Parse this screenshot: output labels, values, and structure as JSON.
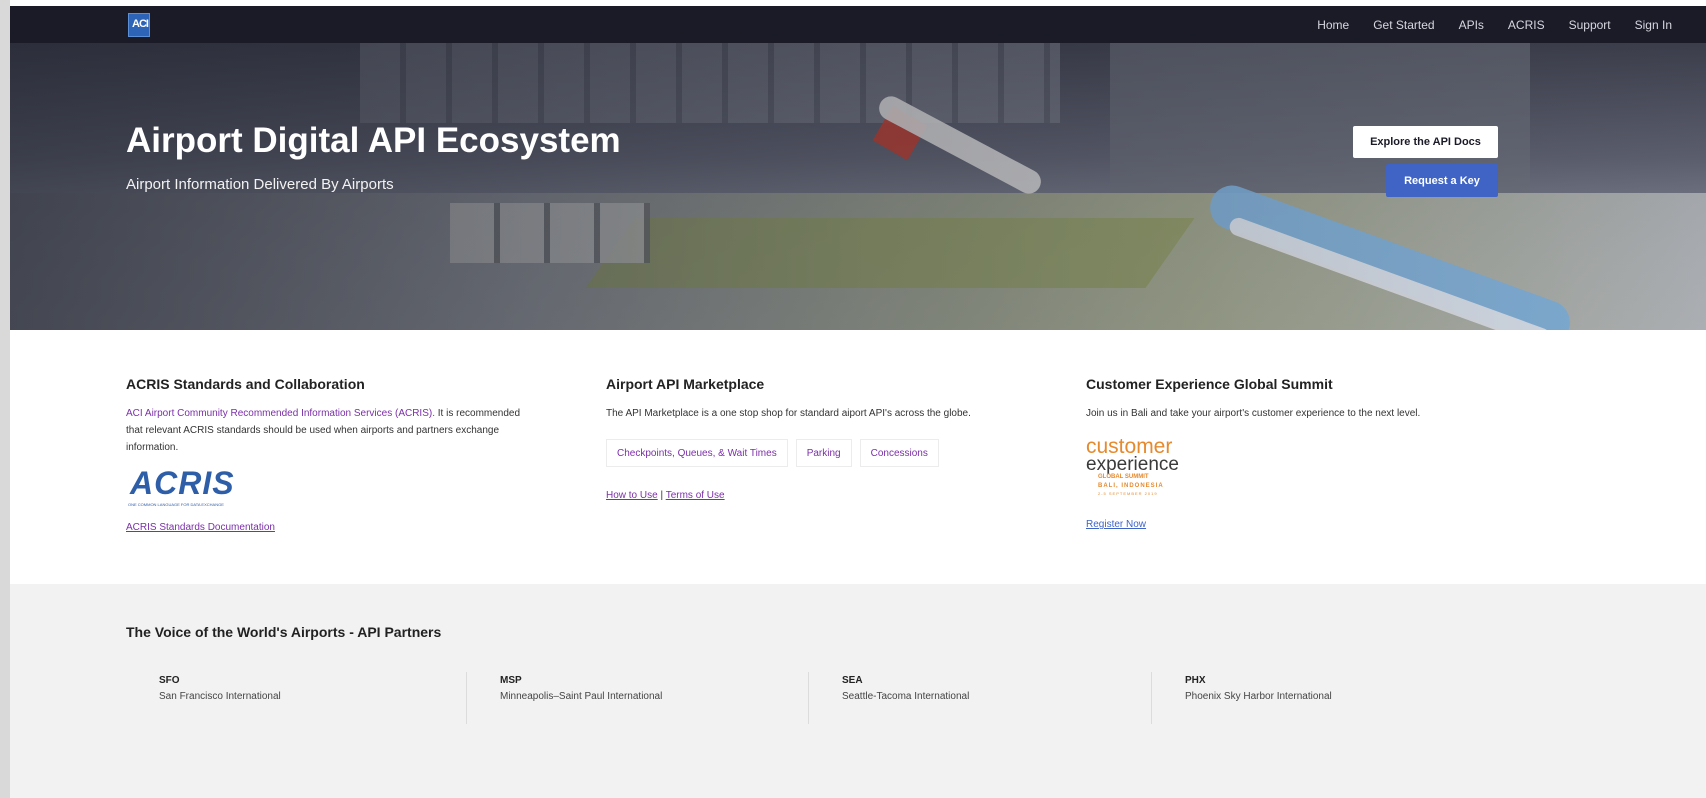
{
  "nav": {
    "logo_text": "ACI",
    "links": [
      "Home",
      "Get Started",
      "APIs",
      "ACRIS",
      "Support",
      "Sign In"
    ]
  },
  "hero": {
    "title": "Airport Digital API Ecosystem",
    "subtitle": "Airport Information Delivered By Airports",
    "docs_button": "Explore the API Docs",
    "key_button": "Request a Key"
  },
  "acris": {
    "heading": "ACRIS Standards and Collaboration",
    "link_text": "ACI Airport Community Recommended Information Services (ACRIS).",
    "body_text": " It is recommended that relevant ACRIS standards should be used when airports and partners exchange information.",
    "logo_text": "ACRIS",
    "logo_tagline": "ONE COMMON LANGUAGE FOR DATA EXCHANGE",
    "doc_link": "ACRIS Standards Documentation"
  },
  "marketplace": {
    "heading": "Airport API Marketplace",
    "body": "The API Marketplace is a one stop shop for standard aiport API's across the globe.",
    "pills": [
      "Checkpoints, Queues, & Wait Times",
      "Parking",
      "Concessions"
    ],
    "how_to_use": "How to Use",
    "separator": "|",
    "terms": "Terms of Use"
  },
  "summit": {
    "heading": "Customer Experience Global Summit",
    "body": "Join us in Bali and take your airport's customer experience to the next level.",
    "logo_line1": "customer",
    "logo_line2": "experience",
    "logo_line3": "GLOBAL SUMMIT",
    "logo_line4": "BALI, INDONESIA",
    "logo_line5": "2-5 SEPTEMBER 2019",
    "register": "Register Now"
  },
  "partners": {
    "heading": "The Voice of the World's Airports - API Partners",
    "items": [
      {
        "code": "SFO",
        "name": "San Francisco International"
      },
      {
        "code": "MSP",
        "name": "Minneapolis–Saint Paul International"
      },
      {
        "code": "SEA",
        "name": "Seattle-Tacoma International"
      },
      {
        "code": "PHX",
        "name": "Phoenix Sky Harbor International"
      }
    ]
  },
  "colors": {
    "nav_bg": "#1b1b28",
    "accent_button": "#3f64c6",
    "link": "#7b2fa8",
    "partners_bg": "#f2f2f2"
  }
}
